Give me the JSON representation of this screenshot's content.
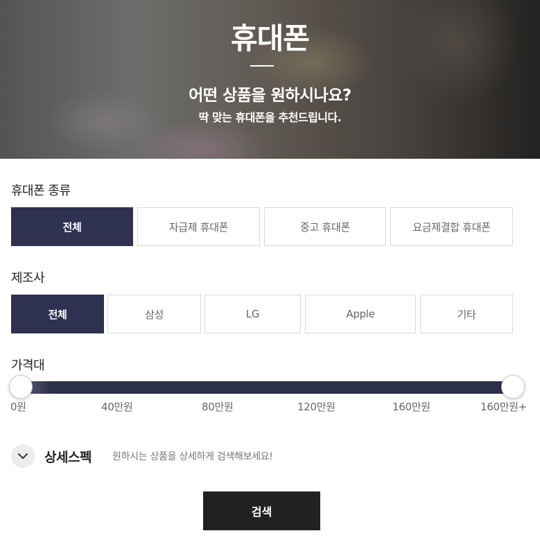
{
  "hero": {
    "title": "휴대폰",
    "subtitle": "어떤 상품을 원하시나요?",
    "description": "딱 맞는 휴대폰을 추천드립니다."
  },
  "phone_type": {
    "title": "휴대폰 종류",
    "options": [
      "전체",
      "자급제 휴대폰",
      "중고 휴대폰",
      "요금제결합 휴대폰"
    ],
    "selected": "전체"
  },
  "manufacturer": {
    "title": "제조사",
    "options": [
      "전체",
      "삼성",
      "LG",
      "Apple",
      "기타"
    ],
    "selected": "전체"
  },
  "price": {
    "title": "가격대",
    "ticks": [
      "0원",
      "40만원",
      "80만원",
      "120만원",
      "160만원",
      "160만원+"
    ],
    "range_min": "0원",
    "range_max": "160만원+"
  },
  "detail": {
    "title": "상세스펙",
    "description": "원하시는 상품을 상세하게 검색해보세요!",
    "icon": "chevron-down-icon"
  },
  "search": {
    "label": "검색"
  },
  "colors": {
    "active": "#2e3150",
    "button_dark": "#222222"
  }
}
